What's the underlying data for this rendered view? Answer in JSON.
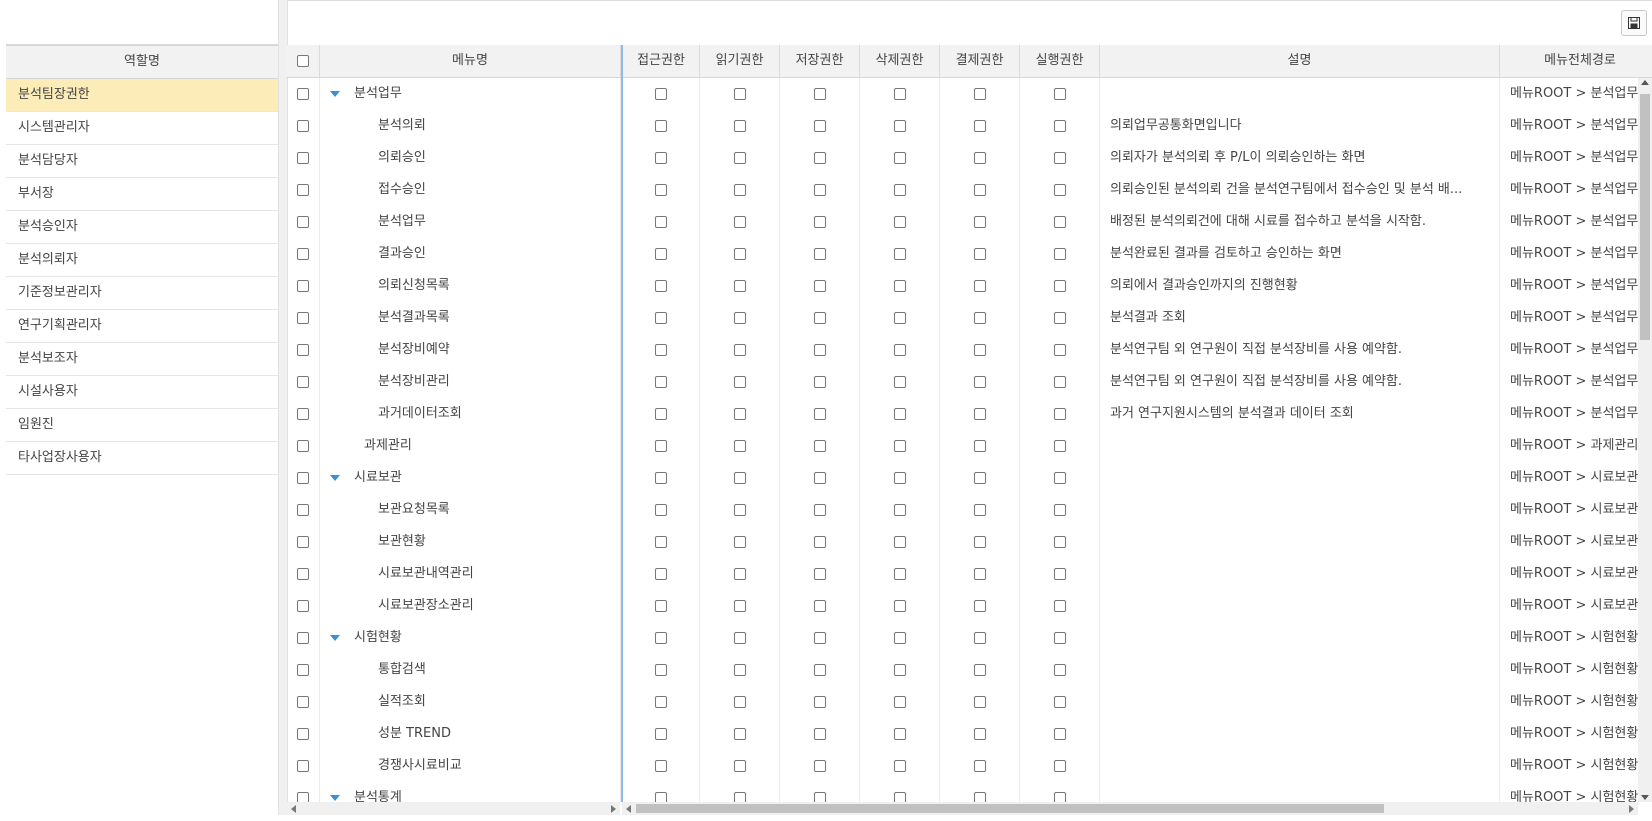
{
  "roles": {
    "header": "역할명",
    "items": [
      "분석팀장권한",
      "시스템관리자",
      "분석담당자",
      "부서장",
      "분석승인자",
      "분석의뢰자",
      "기준정보관리자",
      "연구기획관리자",
      "분석보조자",
      "시설사용자",
      "임원진",
      "타사업장사용자"
    ],
    "selected_index": 0
  },
  "toolbar": {
    "save_icon": "save-icon"
  },
  "grid": {
    "columns": {
      "menu": "메뉴명",
      "access": "접근권한",
      "read": "읽기권한",
      "save": "저장권한",
      "delete": "삭제권한",
      "approve": "결제권한",
      "execute": "실행권한",
      "desc": "설명",
      "path": "메뉴전체경로"
    },
    "rows": [
      {
        "menu": "분석업무",
        "level": "parent",
        "desc": "",
        "path": "메뉴ROOT > 분석업무"
      },
      {
        "menu": "분석의뢰",
        "level": "child",
        "desc": "의뢰업무공통화면입니다",
        "path": "메뉴ROOT > 분석업무"
      },
      {
        "menu": "의뢰승인",
        "level": "child",
        "desc": "의뢰자가 분석의뢰 후 P/L이 의뢰승인하는 화면",
        "path": "메뉴ROOT > 분석업무"
      },
      {
        "menu": "접수승인",
        "level": "child",
        "desc": "의뢰승인된 분석의뢰 건을 분석연구팀에서 접수승인 및 분석 배...",
        "path": "메뉴ROOT > 분석업무"
      },
      {
        "menu": "분석업무",
        "level": "child",
        "desc": "배정된 분석의뢰건에 대해 시료를 접수하고 분석을 시작함.",
        "path": "메뉴ROOT > 분석업무"
      },
      {
        "menu": "결과승인",
        "level": "child",
        "desc": "분석완료된 결과를 검토하고 승인하는 화면",
        "path": "메뉴ROOT > 분석업무"
      },
      {
        "menu": "의뢰신청목록",
        "level": "child",
        "desc": "의뢰에서 결과승인까지의 진행현황",
        "path": "메뉴ROOT > 분석업무"
      },
      {
        "menu": "분석결과목록",
        "level": "child",
        "desc": "분석결과 조회",
        "path": "메뉴ROOT > 분석업무"
      },
      {
        "menu": "분석장비예약",
        "level": "child",
        "desc": "분석연구팀 외 연구원이 직접 분석장비를 사용 예약함.",
        "path": "메뉴ROOT > 분석업무"
      },
      {
        "menu": "분석장비관리",
        "level": "child",
        "desc": "분석연구팀 외 연구원이 직접 분석장비를 사용 예약함.",
        "path": "메뉴ROOT > 분석업무"
      },
      {
        "menu": "과거데이터조회",
        "level": "child",
        "desc": "과거 연구지원시스템의 분석결과 데이터 조회",
        "path": "메뉴ROOT > 분석업무"
      },
      {
        "menu": "과제관리",
        "level": "leaf",
        "desc": "",
        "path": "메뉴ROOT > 과제관리"
      },
      {
        "menu": "시료보관",
        "level": "parent",
        "desc": "",
        "path": "메뉴ROOT > 시료보관"
      },
      {
        "menu": "보관요청목록",
        "level": "child",
        "desc": "",
        "path": "메뉴ROOT > 시료보관"
      },
      {
        "menu": "보관현황",
        "level": "child",
        "desc": "",
        "path": "메뉴ROOT > 시료보관"
      },
      {
        "menu": "시료보관내역관리",
        "level": "child",
        "desc": "",
        "path": "메뉴ROOT > 시료보관"
      },
      {
        "menu": "시료보관장소관리",
        "level": "child",
        "desc": "",
        "path": "메뉴ROOT > 시료보관"
      },
      {
        "menu": "시험현황",
        "level": "parent",
        "desc": "",
        "path": "메뉴ROOT > 시험현황"
      },
      {
        "menu": "통합검색",
        "level": "child",
        "desc": "",
        "path": "메뉴ROOT > 시험현황"
      },
      {
        "menu": "실적조회",
        "level": "child",
        "desc": "",
        "path": "메뉴ROOT > 시험현황"
      },
      {
        "menu": "성분 TREND",
        "level": "child",
        "desc": "",
        "path": "메뉴ROOT > 시험현황"
      },
      {
        "menu": "경쟁사시료비교",
        "level": "child",
        "desc": "",
        "path": "메뉴ROOT > 시험현황"
      },
      {
        "menu": "분석통계",
        "level": "parent",
        "desc": "",
        "path": "메뉴ROOT > 시험현황"
      }
    ]
  }
}
